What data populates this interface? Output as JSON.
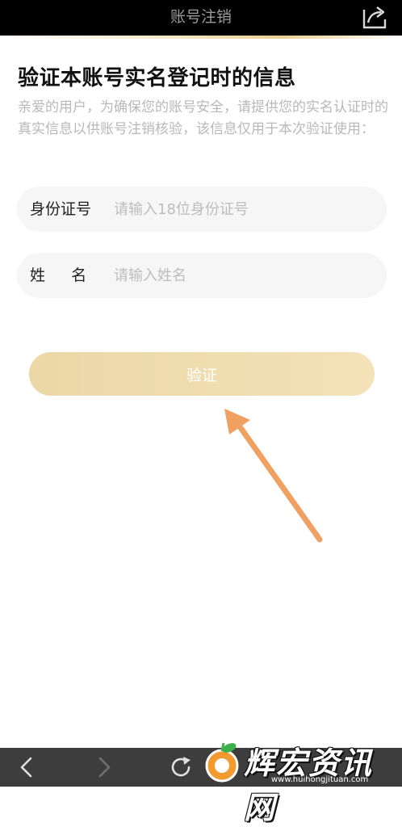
{
  "header": {
    "title": "账号注销",
    "share_icon": "share-icon"
  },
  "main": {
    "heading": "验证本账号实名登记时的信息",
    "description": "亲爱的用户，为确保您的账号安全，请提供您的实名认证时的真实信息以供账号注销核验，该信息仅用于本次验证使用："
  },
  "form": {
    "id_number": {
      "label": "身份证号",
      "placeholder": "请输入18位身份证号",
      "value": ""
    },
    "name": {
      "label": "姓名",
      "placeholder": "请输入姓名",
      "value": ""
    },
    "verify_label": "验证"
  },
  "browser_nav": {
    "back_icon": "back-arrow-icon",
    "forward_icon": "forward-arrow-icon",
    "refresh_icon": "refresh-icon"
  },
  "watermark": {
    "text": "辉宏资讯网",
    "url": "www.huihongjituan.com"
  },
  "colors": {
    "topbar_bg": "#000000",
    "accent_gold": "#ecd7a6",
    "arrow_orange": "#f0a060",
    "bottombar_bg": "#3d3d3d"
  }
}
